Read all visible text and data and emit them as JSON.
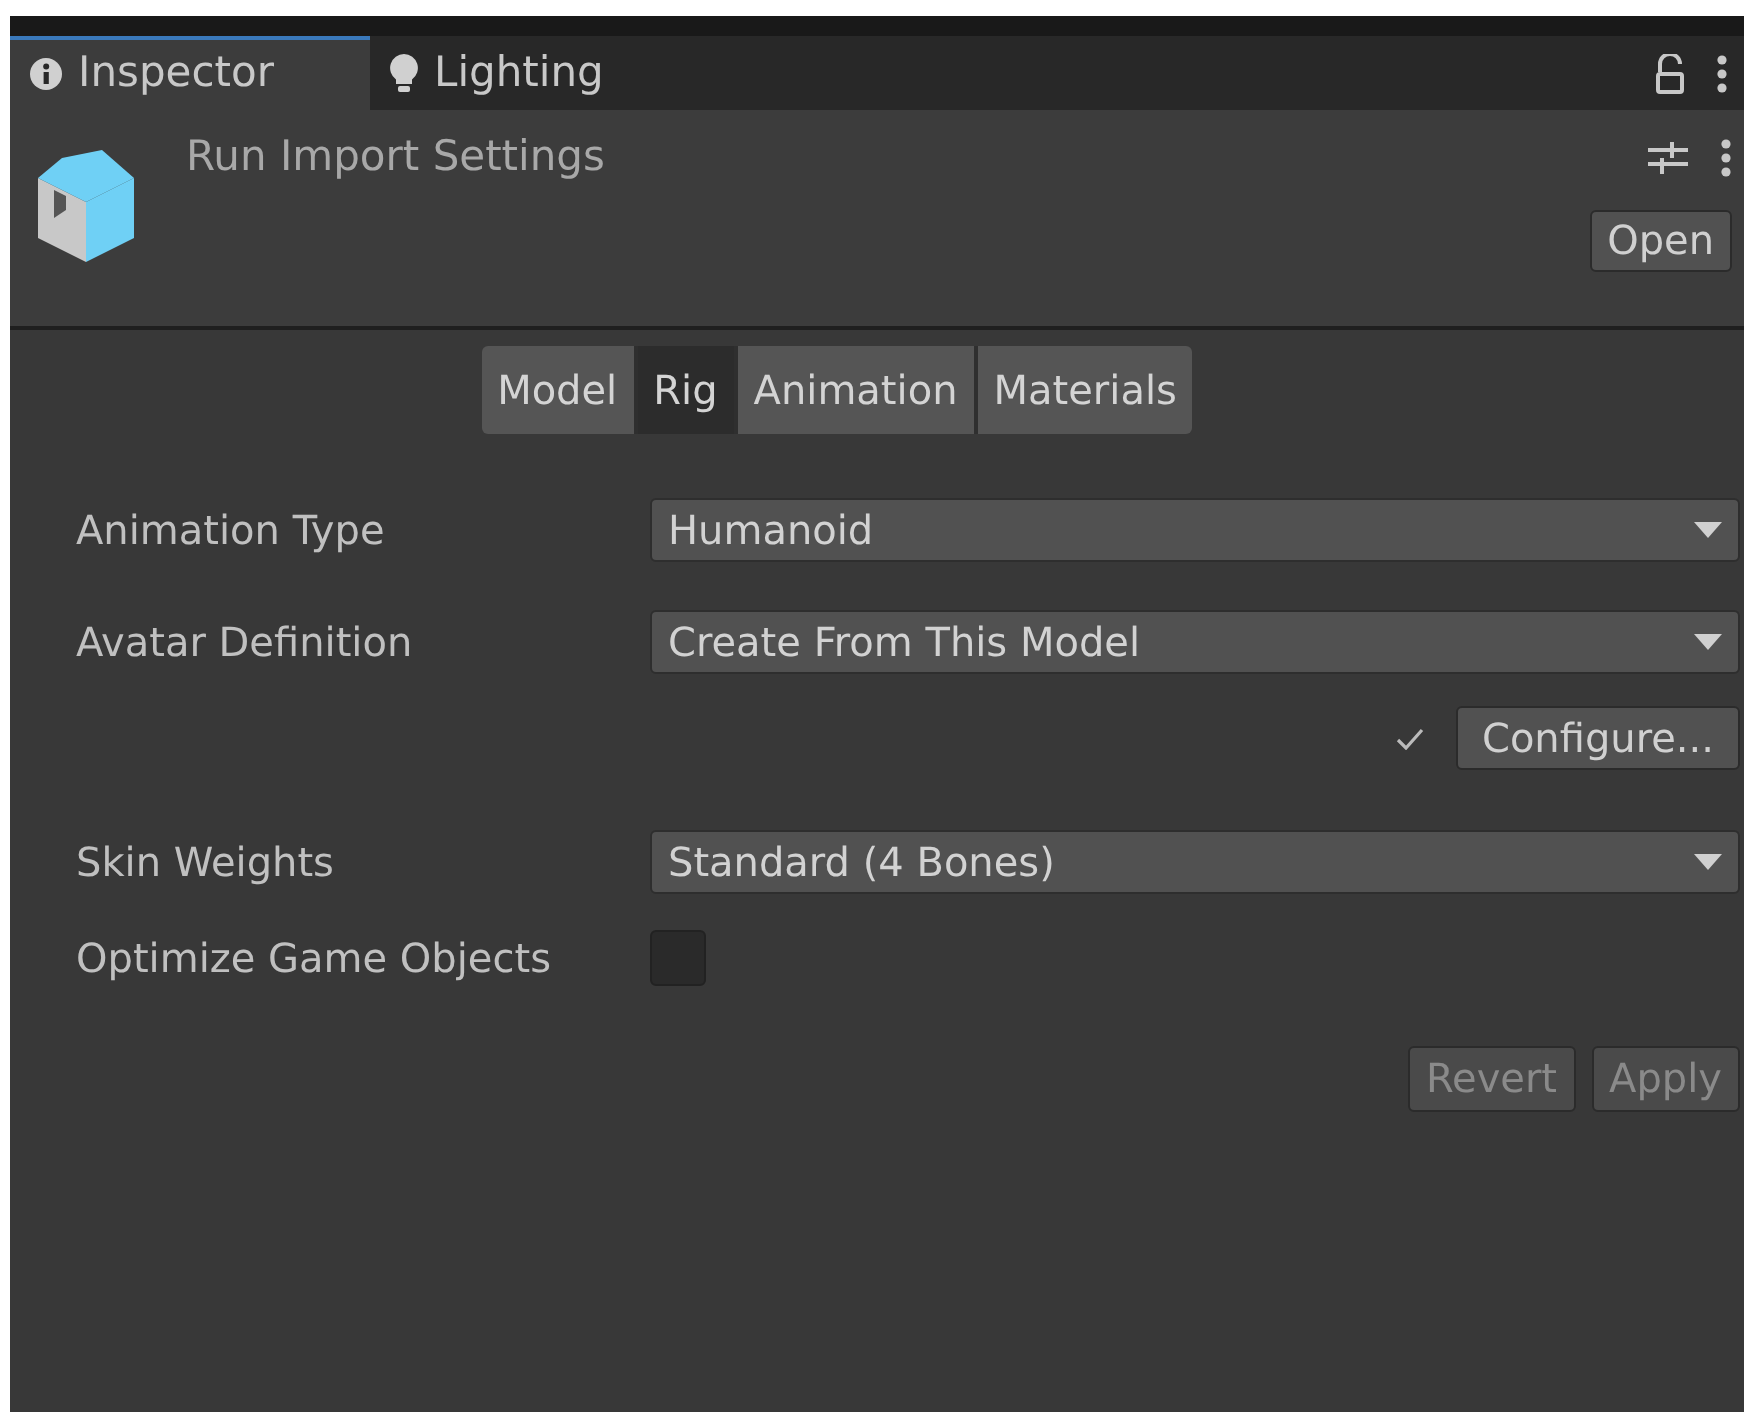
{
  "window_tabs": [
    {
      "label": "Inspector",
      "selected": true
    },
    {
      "label": "Lighting",
      "selected": false
    }
  ],
  "header": {
    "title": "Run Import Settings",
    "open_button": "Open"
  },
  "section_tabs": [
    {
      "label": "Model",
      "selected": false
    },
    {
      "label": "Rig",
      "selected": true
    },
    {
      "label": "Animation",
      "selected": false
    },
    {
      "label": "Materials",
      "selected": false
    }
  ],
  "fields": [
    {
      "kind": "dropdown",
      "label": "Animation Type",
      "value": "Humanoid"
    },
    {
      "kind": "dropdown",
      "label": "Avatar Definition",
      "value": "Create From This Model"
    },
    {
      "kind": "button",
      "label": "Configure...",
      "valid": true
    },
    {
      "kind": "dropdown",
      "label": "Skin Weights",
      "value": "Standard (4 Bones)"
    },
    {
      "kind": "checkbox",
      "label": "Optimize Game Objects",
      "checked": false
    }
  ],
  "footer_buttons": [
    {
      "label": "Revert",
      "disabled": true
    },
    {
      "label": "Apply",
      "disabled": true
    }
  ]
}
